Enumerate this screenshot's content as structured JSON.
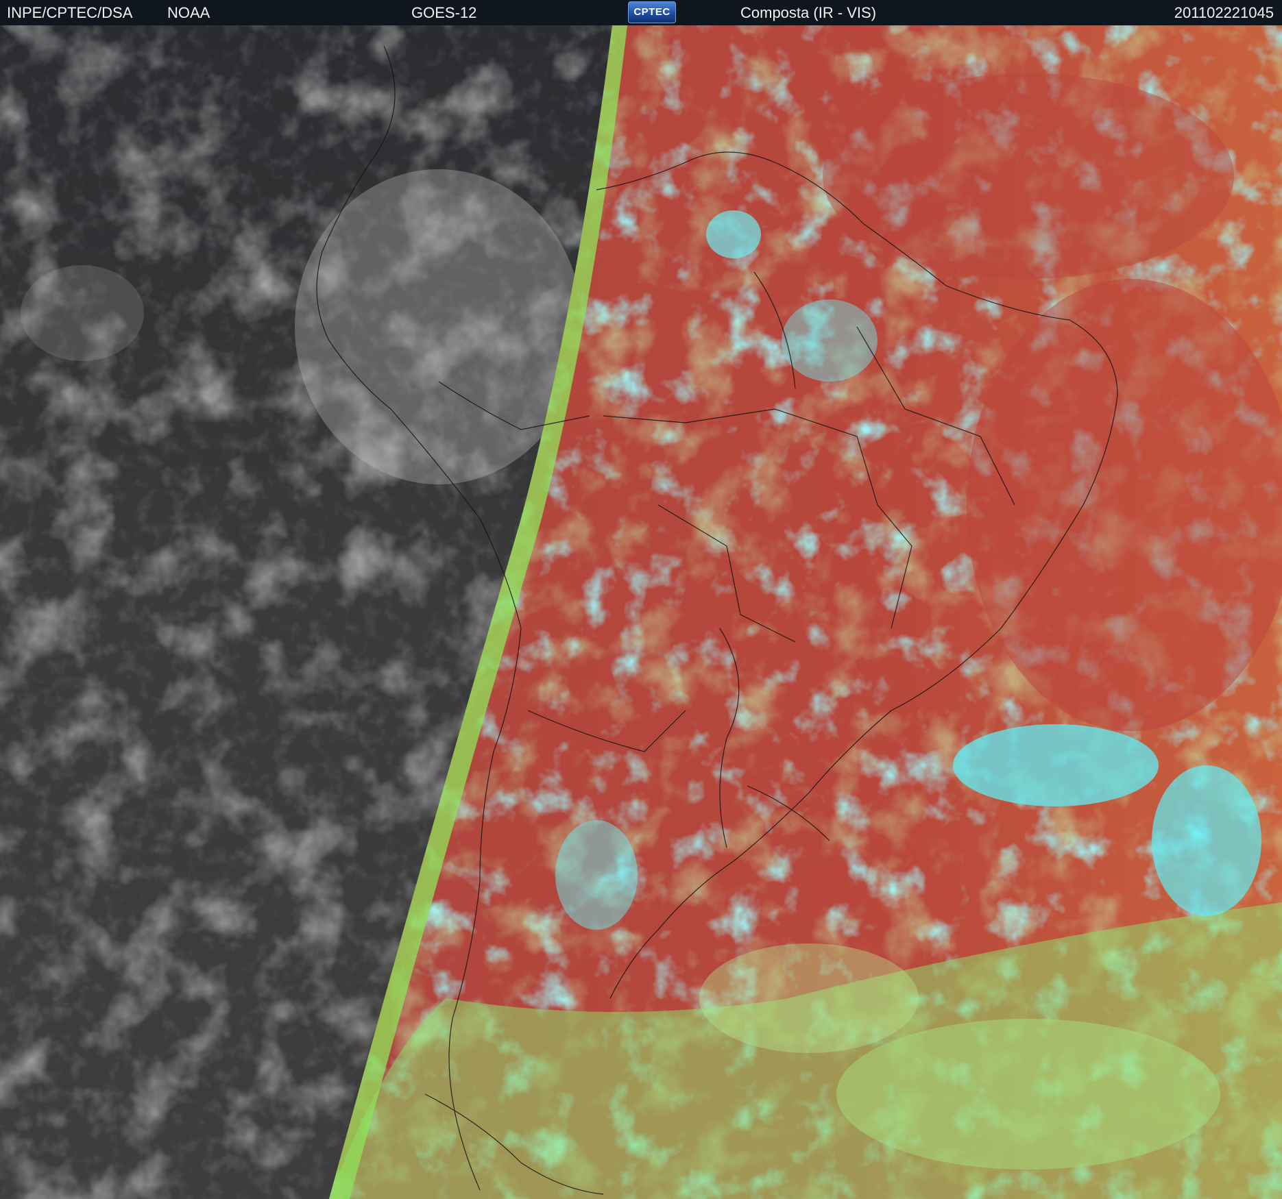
{
  "header": {
    "org": "INPE/CPTEC/DSA",
    "agency": "NOAA",
    "satellite": "GOES-12",
    "logo_text": "CPTEC",
    "product": "Composta (IR - VIS)",
    "timestamp": "201102221045"
  },
  "colors": {
    "header_bg": "#10161d",
    "night_side": "#3a3a3a",
    "day_side_red": "#b4453c",
    "cloud_cyan": "#4fe8f0",
    "cloud_green": "#92e36a",
    "terminator_green": "#8fe35a",
    "borders": "#111111"
  },
  "icons": {
    "logo": "cptec-logo"
  }
}
